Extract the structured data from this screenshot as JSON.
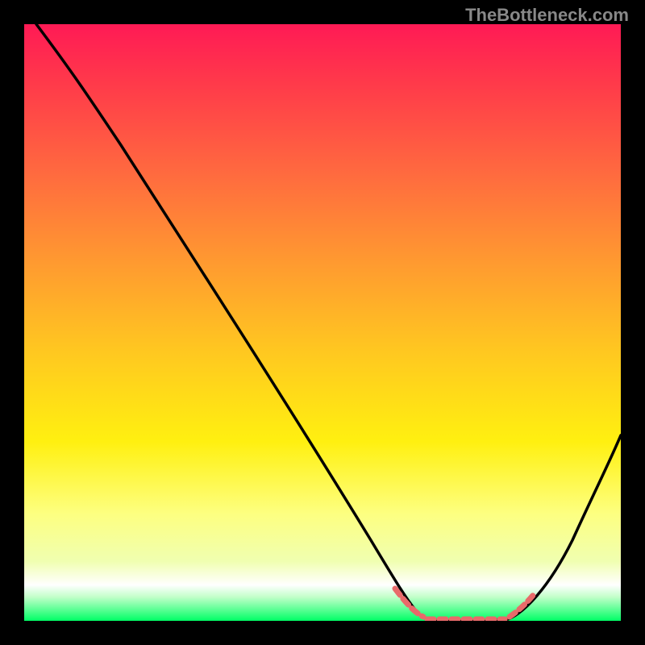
{
  "watermark": "TheBottleneck.com",
  "colors": {
    "background": "#000000",
    "curve": "#000000",
    "dashes": "#e86a6a"
  },
  "chart_data": {
    "type": "line",
    "title": "",
    "xlabel": "",
    "ylabel": "",
    "x_range": [
      0,
      100
    ],
    "y_range": [
      0,
      100
    ],
    "series": [
      {
        "name": "bottleneck-curve",
        "description": "V-shaped performance curve descending from top-left to a flat minimum near x≈70-80, then rising toward the right",
        "x": [
          2,
          8,
          15,
          25,
          35,
          45,
          55,
          60,
          64,
          68,
          72,
          76,
          80,
          84,
          88,
          92,
          98
        ],
        "values": [
          100,
          93,
          82,
          67,
          52,
          37,
          22,
          14,
          7,
          2,
          0,
          0,
          0,
          2,
          8,
          16,
          30
        ]
      }
    ],
    "optimal_region": {
      "description": "flat minimum of curve highlighted with salmon dashed markers",
      "x_start": 62,
      "x_end": 85,
      "y": 0
    }
  }
}
